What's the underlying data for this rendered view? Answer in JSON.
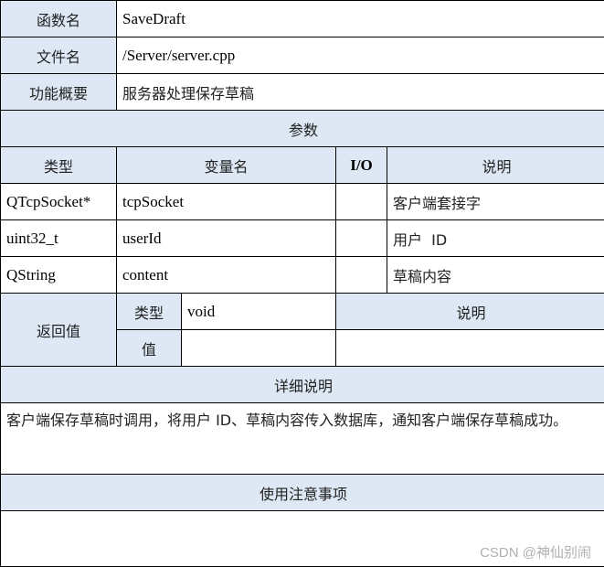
{
  "function_name": {
    "label": "函数名",
    "value": "SaveDraft"
  },
  "file_name": {
    "label": "文件名",
    "value": "/Server/server.cpp"
  },
  "summary": {
    "label": "功能概要",
    "value": "服务器处理保存草稿"
  },
  "params": {
    "title": "参数",
    "headers": {
      "type": "类型",
      "name": "变量名",
      "io": "I/O",
      "desc": "说明"
    },
    "rows": [
      {
        "type": "QTcpSocket*",
        "name": "tcpSocket",
        "io": "",
        "desc": "客户端套接字"
      },
      {
        "type": "uint32_t",
        "name": "userId",
        "io": "",
        "desc": "用户  ID"
      },
      {
        "type": "QString",
        "name": "content",
        "io": "",
        "desc": "草稿内容"
      }
    ]
  },
  "return": {
    "label": "返回值",
    "type_label": "类型",
    "type_value": "void",
    "value_label": "值",
    "value_value": "",
    "desc_label": "说明",
    "desc_value": ""
  },
  "details": {
    "title": "详细说明",
    "text": "客户端保存草稿时调用，将用户  ID、草稿内容传入数据库，通知客户端保存草稿成功。"
  },
  "notes": {
    "title": "使用注意事项",
    "text": ""
  },
  "watermark": "CSDN @神仙别闹"
}
